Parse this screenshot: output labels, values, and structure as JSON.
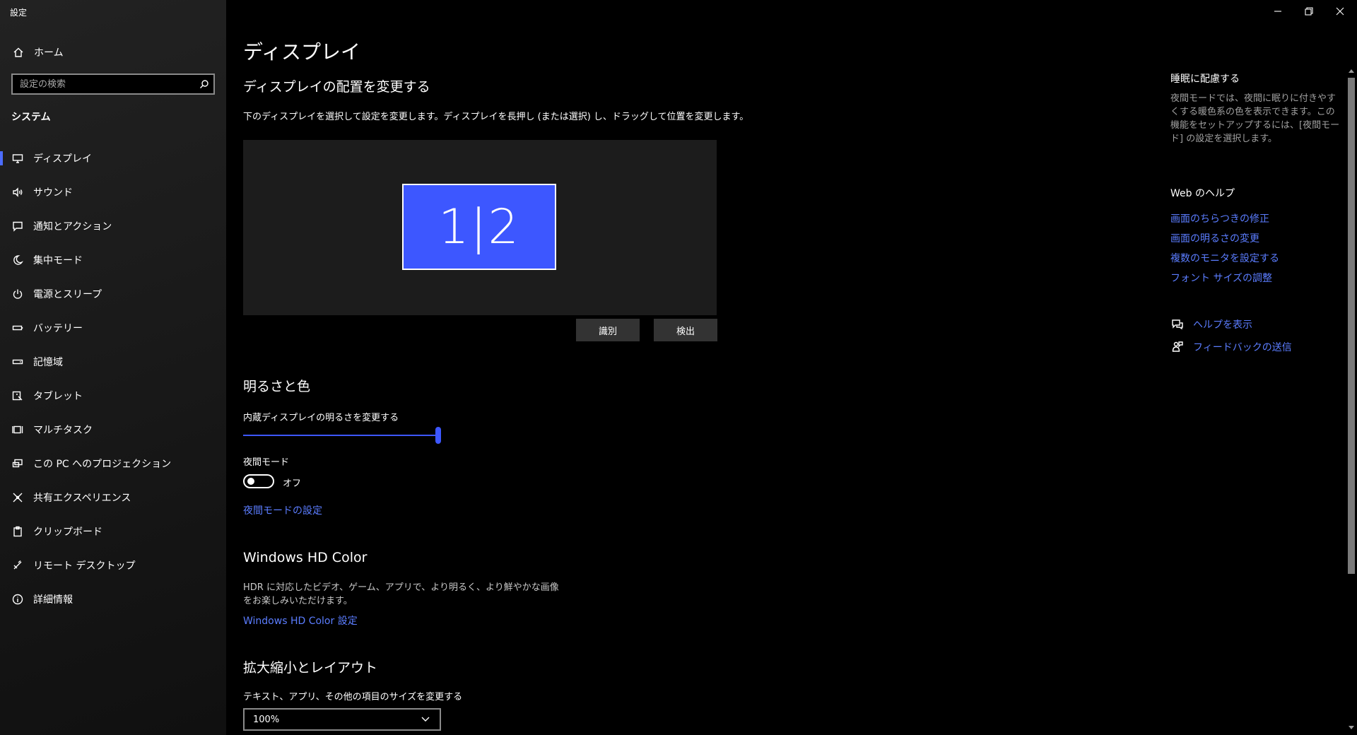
{
  "window": {
    "title": "設定",
    "controls": [
      {
        "name": "minimize",
        "icon": "minimize-icon"
      },
      {
        "name": "restore",
        "icon": "restore-icon"
      },
      {
        "name": "close",
        "icon": "close-icon"
      }
    ]
  },
  "sidebar": {
    "home_label": "ホーム",
    "search_placeholder": "設定の検索",
    "section_title": "システム",
    "items": [
      {
        "label": "ディスプレイ",
        "icon": "monitor-icon",
        "active": true
      },
      {
        "label": "サウンド",
        "icon": "speaker-icon"
      },
      {
        "label": "通知とアクション",
        "icon": "notification-icon"
      },
      {
        "label": "集中モード",
        "icon": "moon-icon"
      },
      {
        "label": "電源とスリープ",
        "icon": "power-icon"
      },
      {
        "label": "バッテリー",
        "icon": "battery-icon"
      },
      {
        "label": "記憶域",
        "icon": "storage-icon"
      },
      {
        "label": "タブレット",
        "icon": "tablet-icon"
      },
      {
        "label": "マルチタスク",
        "icon": "multitask-icon"
      },
      {
        "label": "この PC へのプロジェクション",
        "icon": "projection-icon"
      },
      {
        "label": "共有エクスペリエンス",
        "icon": "share-icon"
      },
      {
        "label": "クリップボード",
        "icon": "clipboard-icon"
      },
      {
        "label": "リモート デスクトップ",
        "icon": "remote-desktop-icon"
      },
      {
        "label": "詳細情報",
        "icon": "info-icon"
      }
    ]
  },
  "main": {
    "title": "ディスプレイ",
    "arrange": {
      "heading": "ディスプレイの配置を変更する",
      "description": "下のディスプレイを選択して設定を変更します。ディスプレイを長押し (または選択) し、ドラッグして位置を変更します。",
      "monitor_label": "1|2",
      "identify_button": "識別",
      "detect_button": "検出"
    },
    "brightness": {
      "heading": "明るさと色",
      "slider_label": "内蔵ディスプレイの明るさを変更する",
      "slider_value": 100,
      "night_mode_label": "夜間モード",
      "night_mode_state": "オフ",
      "night_mode_link": "夜間モードの設定"
    },
    "hdcolor": {
      "heading": "Windows HD Color",
      "text": "HDR に対応したビデオ、ゲーム、アプリで、より明るく、より鮮やかな画像をお楽しみいただけます。",
      "link": "Windows HD Color 設定"
    },
    "scale": {
      "heading": "拡大縮小とレイアウト",
      "label": "テキスト、アプリ、その他の項目のサイズを変更する",
      "value": "100%"
    }
  },
  "right": {
    "sleep_title": "睡眠に配慮する",
    "sleep_text": "夜間モードでは、夜間に眠りに付きやすくする暖色系の色を表示できます。この機能をセットアップするには、[夜間モード] の設定を選択します。",
    "web_help_title": "Web のヘルプ",
    "web_links": [
      "画面のちらつきの修正",
      "画面の明るさの変更",
      "複数のモニタを設定する",
      "フォント サイズの調整"
    ],
    "help_link": "ヘルプを表示",
    "feedback_link": "フィードバックの送信"
  },
  "colors": {
    "accent": "#3d57ff",
    "link": "#5b7dff"
  }
}
